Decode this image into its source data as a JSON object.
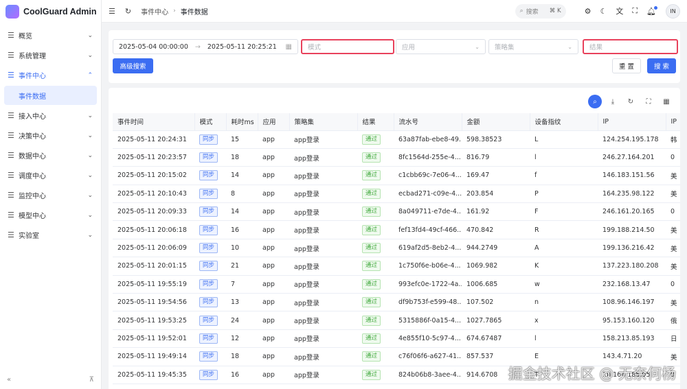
{
  "app": {
    "title": "CoolGuard Admin"
  },
  "sidebar": {
    "items": [
      {
        "label": "概览",
        "icon": "menu-icon",
        "expanded": false
      },
      {
        "label": "系统管理",
        "icon": "menu-icon",
        "expanded": false
      },
      {
        "label": "事件中心",
        "icon": "menu-icon",
        "expanded": true,
        "active": true,
        "children": [
          {
            "label": "事件数据",
            "active": true
          }
        ]
      },
      {
        "label": "接入中心",
        "icon": "menu-icon",
        "expanded": false
      },
      {
        "label": "决策中心",
        "icon": "menu-icon",
        "expanded": false
      },
      {
        "label": "数据中心",
        "icon": "menu-icon",
        "expanded": false
      },
      {
        "label": "调度中心",
        "icon": "menu-icon",
        "expanded": false
      },
      {
        "label": "监控中心",
        "icon": "menu-icon",
        "expanded": false
      },
      {
        "label": "模型中心",
        "icon": "menu-icon",
        "expanded": false
      },
      {
        "label": "实验室",
        "icon": "menu-icon",
        "expanded": false
      }
    ],
    "collapse_icon": "«",
    "pin_icon": "⊼"
  },
  "header": {
    "breadcrumb": [
      "事件中心",
      "事件数据"
    ],
    "search": {
      "placeholder": "搜索",
      "shortcut": "⌘ K"
    },
    "avatar_text": "IN"
  },
  "filters": {
    "date_start": "2025-05-04 00:00:00",
    "date_end": "2025-05-11 20:25:21",
    "mode_placeholder": "模式",
    "app_placeholder": "应用",
    "strategy_placeholder": "策略集",
    "result_placeholder": "结果",
    "advanced_label": "高级搜索",
    "reset_label": "重 置",
    "search_label": "搜 索"
  },
  "table": {
    "columns": [
      "事件时间",
      "模式",
      "耗时ms",
      "应用",
      "策略集",
      "结果",
      "流水号",
      "金额",
      "设备指纹",
      "IP",
      "IP"
    ],
    "rows": [
      [
        "2025-05-11 20:24:31",
        "同步",
        "15",
        "app",
        "app登录",
        "通过",
        "63a87fab-ebe8-49...",
        "598.38523",
        "L",
        "124.254.195.178",
        "韩"
      ],
      [
        "2025-05-11 20:23:57",
        "同步",
        "18",
        "app",
        "app登录",
        "通过",
        "8fc1564d-255e-4...",
        "816.79",
        "l",
        "246.27.164.201",
        "0"
      ],
      [
        "2025-05-11 20:15:02",
        "同步",
        "14",
        "app",
        "app登录",
        "通过",
        "c1cbb69c-7e06-4...",
        "169.47",
        "f",
        "146.183.151.56",
        "美"
      ],
      [
        "2025-05-11 20:10:43",
        "同步",
        "8",
        "app",
        "app登录",
        "通过",
        "ecbad271-c09e-4...",
        "203.854",
        "P",
        "164.235.98.122",
        "美"
      ],
      [
        "2025-05-11 20:09:33",
        "同步",
        "14",
        "app",
        "app登录",
        "通过",
        "8a049711-e7de-4...",
        "161.92",
        "F",
        "246.161.20.165",
        "0"
      ],
      [
        "2025-05-11 20:06:18",
        "同步",
        "16",
        "app",
        "app登录",
        "通过",
        "fef13fd4-49cf-466...",
        "470.842",
        "R",
        "199.188.214.50",
        "美"
      ],
      [
        "2025-05-11 20:06:09",
        "同步",
        "10",
        "app",
        "app登录",
        "通过",
        "619af2d5-8eb2-4...",
        "944.2749",
        "A",
        "199.136.216.42",
        "美"
      ],
      [
        "2025-05-11 20:01:15",
        "同步",
        "21",
        "app",
        "app登录",
        "通过",
        "1c750f6e-b06e-4...",
        "1069.982",
        "K",
        "137.223.180.208",
        "美"
      ],
      [
        "2025-05-11 19:55:19",
        "同步",
        "7",
        "app",
        "app登录",
        "通过",
        "993efc0e-1722-4a...",
        "1006.685",
        "w",
        "232.168.13.47",
        "0"
      ],
      [
        "2025-05-11 19:54:56",
        "同步",
        "13",
        "app",
        "app登录",
        "通过",
        "df9b753f-e599-48...",
        "107.502",
        "n",
        "108.96.146.197",
        "美"
      ],
      [
        "2025-05-11 19:53:25",
        "同步",
        "24",
        "app",
        "app登录",
        "通过",
        "5315886f-0a15-4...",
        "1027.7865",
        "x",
        "95.153.160.120",
        "俄"
      ],
      [
        "2025-05-11 19:52:01",
        "同步",
        "12",
        "app",
        "app登录",
        "通过",
        "4e855f10-5c97-4...",
        "674.67487",
        "l",
        "158.213.85.193",
        "日"
      ],
      [
        "2025-05-11 19:49:14",
        "同步",
        "18",
        "app",
        "app登录",
        "通过",
        "c76f06f6-a627-41...",
        "857.537",
        "E",
        "143.4.71.20",
        "美"
      ],
      [
        "2025-05-11 19:45:35",
        "同步",
        "16",
        "app",
        "app登录",
        "通过",
        "824b06b8-3aee-4...",
        "914.6708",
        "T",
        "10.164.185.95",
        "0"
      ]
    ]
  },
  "watermark": "掘金技术社区 @ 无奈何杨",
  "colors": {
    "primary": "#3b6df2",
    "highlight_border": "#e8415b",
    "success": "#3ea83a"
  }
}
